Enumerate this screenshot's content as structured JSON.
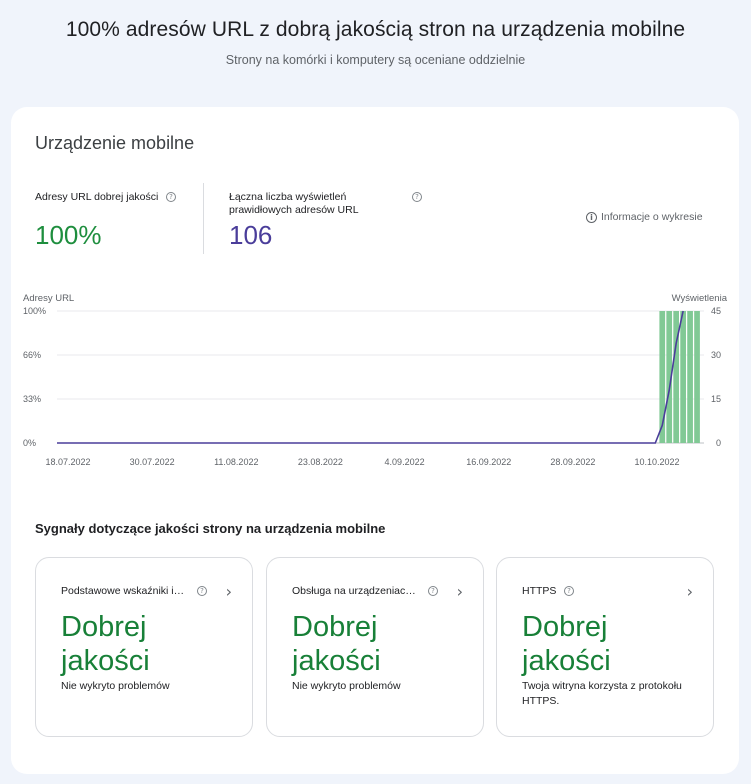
{
  "header": {
    "title": "100% adresów URL z dobrą jakością stron na urządzenia mobilne",
    "subtitle": "Strony na komórki i komputery są oceniane oddzielnie"
  },
  "card": {
    "title": "Urządzenie mobilne",
    "metrics": [
      {
        "label": "Adresy URL dobrej jakości",
        "value": "100%",
        "color": "#1e8e3e"
      },
      {
        "label_line1": "Łączna liczba wyświetleń",
        "label_line2": "prawidłowych adresów URL",
        "value": "106",
        "color": "#4a3d9a"
      }
    ],
    "info_link": "Informacje o wykresie"
  },
  "chart_data": {
    "type": "bar",
    "left_axis_title": "Adresy URL",
    "right_axis_title": "Wyświetlenia",
    "left_ticks": [
      "100%",
      "66%",
      "33%",
      "0%"
    ],
    "right_ticks": [
      "45",
      "30",
      "15",
      "0"
    ],
    "ylim_left": [
      0,
      100
    ],
    "ylim_right": [
      0,
      45
    ],
    "grid": true,
    "x_labels": [
      "18.07.2022",
      "30.07.2022",
      "11.08.2022",
      "23.08.2022",
      "4.09.2022",
      "16.09.2022",
      "28.09.2022",
      "10.10.2022"
    ],
    "x_range": [
      "2022-07-18",
      "2022-10-19"
    ],
    "series": [
      {
        "kind": "bar",
        "axis": "left",
        "color": "#81c995",
        "points": [
          {
            "x": "2022-10-13",
            "y": 100
          },
          {
            "x": "2022-10-14",
            "y": 100
          },
          {
            "x": "2022-10-15",
            "y": 100
          },
          {
            "x": "2022-10-16",
            "y": 100
          },
          {
            "x": "2022-10-17",
            "y": 100
          },
          {
            "x": "2022-10-18",
            "y": 100
          }
        ]
      },
      {
        "kind": "line",
        "axis": "right",
        "color": "#4a3d9a",
        "points": [
          {
            "x": "2022-07-18",
            "y": 0
          },
          {
            "x": "2022-10-12",
            "y": 0
          },
          {
            "x": "2022-10-13",
            "y": 6
          },
          {
            "x": "2022-10-14",
            "y": 18
          },
          {
            "x": "2022-10-15",
            "y": 34
          },
          {
            "x": "2022-10-16",
            "y": 45
          }
        ]
      }
    ]
  },
  "signals": {
    "title": "Sygnały dotyczące jakości strony na urządzenia mobilne",
    "tiles": [
      {
        "label": "Podstawowe wskaźniki internetowe",
        "status": "Dobrej jakości",
        "desc": "Nie wykryto problemów"
      },
      {
        "label": "Obsługa na urządzeniach mobilnych",
        "status": "Dobrej jakości",
        "desc": "Nie wykryto problemów"
      },
      {
        "label": "HTTPS",
        "status": "Dobrej jakości",
        "desc": "Twoja witryna korzysta z protokołu HTTPS."
      }
    ]
  },
  "colors": {
    "good_green": "#188038",
    "bar_green": "#81c995",
    "line_purple": "#4a3d9a"
  }
}
